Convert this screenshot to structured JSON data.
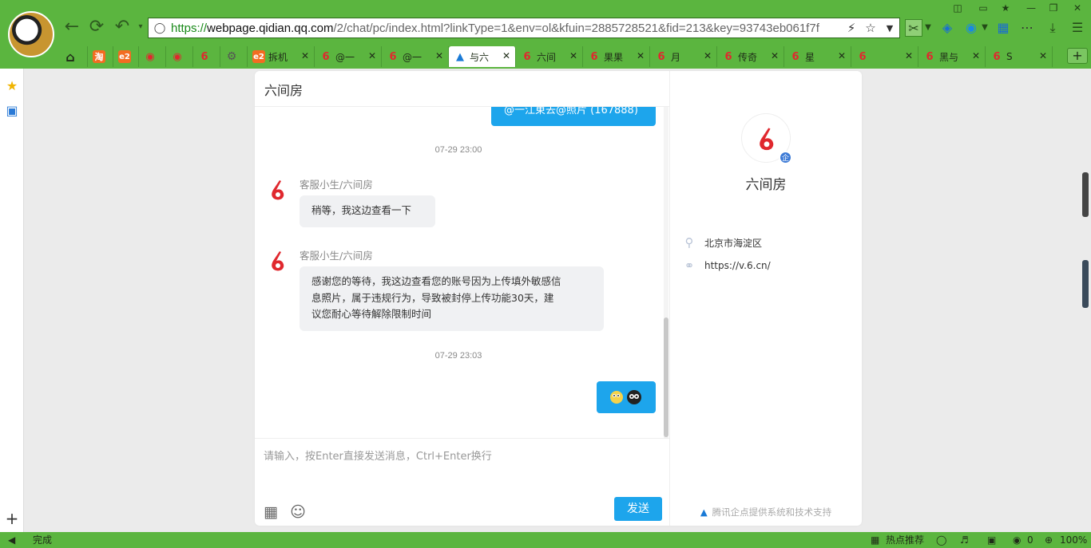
{
  "browser": {
    "url_scheme": "https://",
    "url_host": "webpage.qidian.qq.com",
    "url_rest": "/2/chat/pc/index.html?linkType=1&env=ol&kfuin=2885728521&fid=213&key=93743eb061f7f",
    "tabs": [
      {
        "label": "拆机",
        "type": "e2"
      },
      {
        "label": "@一",
        "type": "six"
      },
      {
        "label": "@一",
        "type": "six"
      },
      {
        "label": "与六",
        "type": "qd",
        "active": true
      },
      {
        "label": "六间",
        "type": "six"
      },
      {
        "label": "果果",
        "type": "six"
      },
      {
        "label": "月",
        "type": "six"
      },
      {
        "label": "传奇",
        "type": "six"
      },
      {
        "label": "星",
        "type": "six"
      },
      {
        "label": "",
        "type": "six"
      },
      {
        "label": "黑与",
        "type": "six"
      },
      {
        "label": "S",
        "type": "six"
      }
    ]
  },
  "chat": {
    "title": "六间房",
    "prev_message": "@一江東去@照片 (167888)",
    "timestamp1": "07-29 23:00",
    "agent_name": "客服小生/六间房",
    "msg1": "稍等，我这边查看一下",
    "msg2_line1": "感谢您的等待，我这边查看您的账号因为上传填外敏感信",
    "msg2_line2": "息照片，属于违规行为，导致被封停上传功能30天，建",
    "msg2_line3": "议您耐心等待解除限制时间",
    "timestamp2": "07-29 23:03",
    "input_placeholder": "请输入，按Enter直接发送消息，Ctrl+Enter换行",
    "send_label": "发送"
  },
  "profile": {
    "name": "六间房",
    "badge": "企",
    "location": "北京市海淀区",
    "website": "https://v.6.cn/",
    "footer": "腾讯企点提供系统和技术支持"
  },
  "status": {
    "left_text": "完成",
    "hot": "热点推荐",
    "count": "0",
    "zoom": "100%"
  },
  "colors": {
    "chrome_green": "#5bb53f",
    "bubble_blue": "#1da5ec",
    "six_red": "#e0282e"
  }
}
